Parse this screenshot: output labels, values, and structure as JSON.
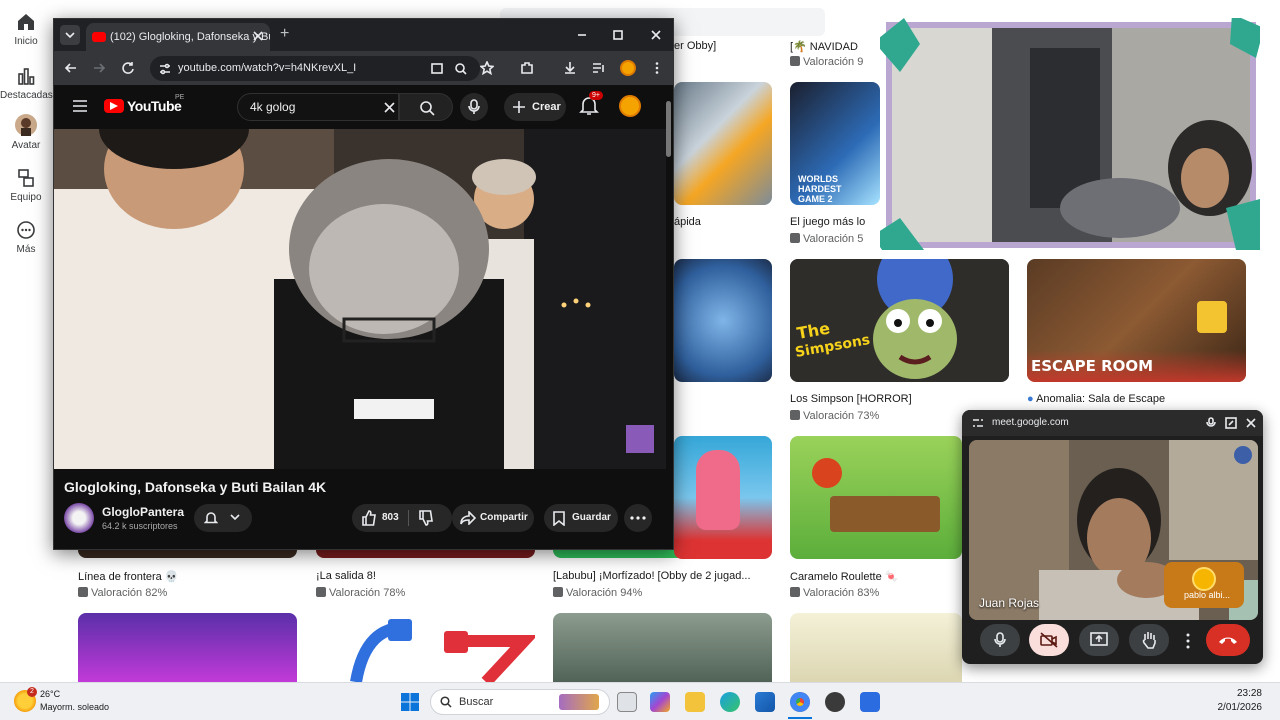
{
  "sidebar": {
    "items": [
      {
        "label": "Inicio",
        "icon": "home-icon"
      },
      {
        "label": "Destacadas",
        "icon": "charts-icon"
      },
      {
        "label": "Avatar",
        "icon": "avatar-icon"
      },
      {
        "label": "Equipo",
        "icon": "party-icon"
      },
      {
        "label": "Más",
        "icon": "more-icon"
      }
    ]
  },
  "roblox": {
    "top_row_partial": [
      {
        "title": "er Obby]"
      },
      {
        "title": "[🌴 NAVIDAD",
        "rating": "Valoración 9"
      }
    ],
    "row1": [
      {
        "title": "ápida",
        "rating": ""
      },
      {
        "title": "El juego más lo",
        "rating": "Valoración 5"
      }
    ],
    "row2": [
      {
        "title": "Los Simpson [HORROR]",
        "rating": "Valoración 73%"
      },
      {
        "title": "Anomalia: Sala de Escape",
        "rating": ""
      }
    ],
    "row3": [
      {
        "title": "Línea de frontera 💀",
        "rating": "Valoración 82%"
      },
      {
        "title": "¡La salida 8!",
        "rating": "Valoración 78%"
      },
      {
        "title": "[Labubu] ¡Morfízado! [Obby de 2 jugad...",
        "rating": "Valoración 94%"
      },
      {
        "title": "Caramelo Roulette 🍬",
        "rating": "Valoración 83%"
      }
    ]
  },
  "browser": {
    "tab_title": "(102) Glogloking, Dafonseka y Bu",
    "url": "youtube.com/watch?v=h4NKrevXL_I",
    "new_tab": "+"
  },
  "youtube": {
    "logo": "YouTube",
    "region": "PE",
    "search_value": "4k golog",
    "create_label": "Crear",
    "notif_badge": "9+",
    "video_title": "Glogloking, Dafonseka y Buti Bailan 4K",
    "channel": "GlogloPantera",
    "subscribers": "64.2 k suscriptores",
    "likes": "803",
    "share_label": "Compartir",
    "save_label": "Guardar"
  },
  "meet": {
    "url": "meet.google.com",
    "participant": "Juan Rojas",
    "tile_name": "pablo albi..."
  },
  "taskbar": {
    "temperature": "26°C",
    "weather": "Mayorm. soleado",
    "search_label": "Buscar",
    "time": "23:28",
    "date": "2/01/2026"
  },
  "colors": {
    "yt_red": "#ff0000",
    "meet_end": "#ea4335",
    "meet_active": "#f9dedc"
  }
}
